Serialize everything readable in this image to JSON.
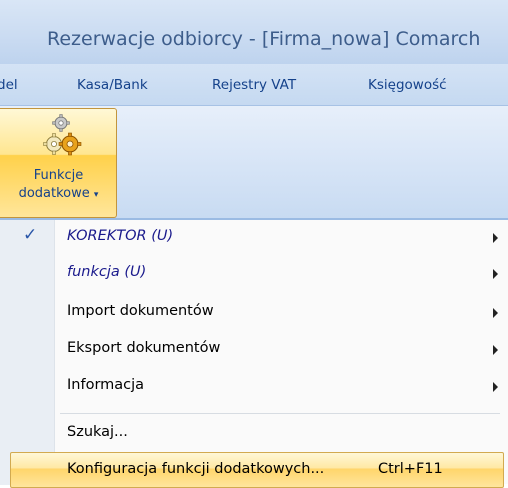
{
  "window": {
    "title": "Rezerwacje odbiorcy - [Firma_nowa] Comarch"
  },
  "menubar": {
    "tabs": [
      {
        "label": "del"
      },
      {
        "label": "Kasa/Bank"
      },
      {
        "label": "Rejestry VAT"
      },
      {
        "label": "Księgowość"
      }
    ]
  },
  "ribbon": {
    "button": {
      "line1": "Funkcje",
      "line2": "dodatkowe",
      "arrow": "▾",
      "icon": "gears-icon"
    }
  },
  "dropdown": {
    "items": [
      {
        "label": "KOREKTOR (U)",
        "checked": true,
        "submenu": true
      },
      {
        "label": "funkcja (U)",
        "checked": false,
        "submenu": true
      },
      {
        "label": "Import dokumentów",
        "checked": false,
        "submenu": true
      },
      {
        "label": "Eksport dokumentów",
        "checked": false,
        "submenu": true
      },
      {
        "label": "Informacja",
        "checked": false,
        "submenu": true
      },
      {
        "label": "Szukaj...",
        "checked": false,
        "submenu": false
      },
      {
        "label": "Konfiguracja funkcji dodatkowych...",
        "shortcut": "Ctrl+F11",
        "highlighted": true
      }
    ],
    "check_glyph": "✓"
  },
  "colors": {
    "menu_text": "#15428b",
    "highlight": "#ffd56a",
    "check": "#2a56a8"
  }
}
